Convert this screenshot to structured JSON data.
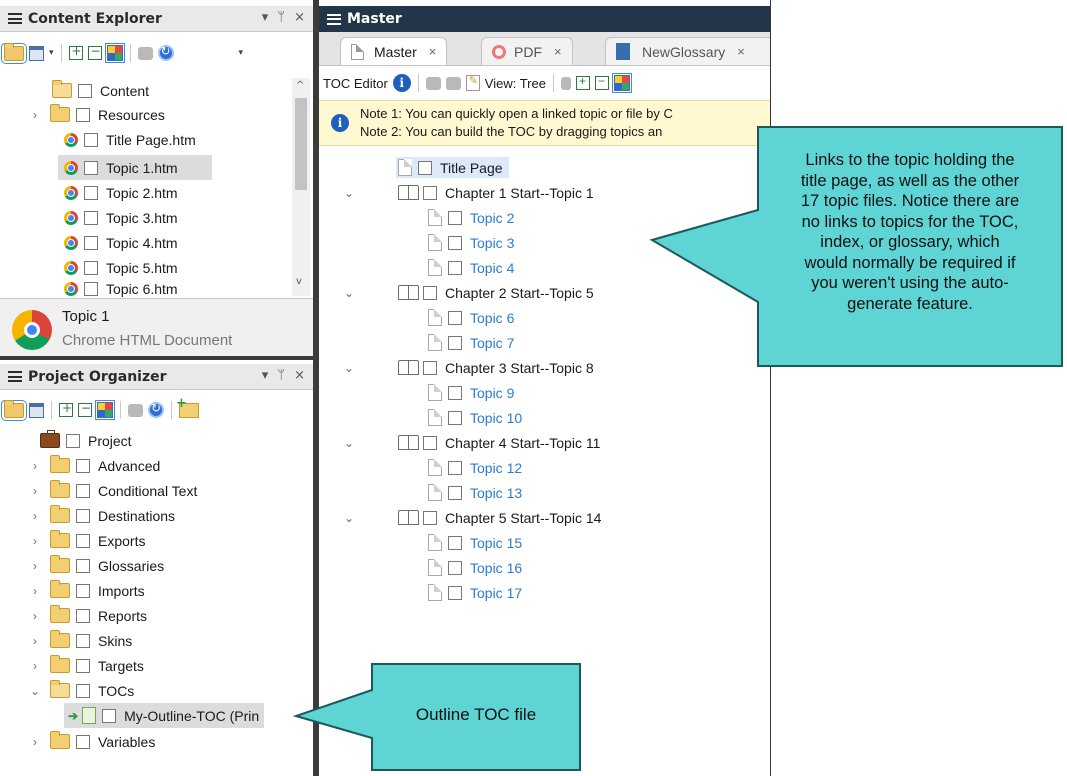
{
  "content_explorer": {
    "title": "Content Explorer",
    "controls": {
      "dropdown": "▾",
      "pin": "ᛘ",
      "close": "×"
    },
    "items": [
      {
        "label": "Content",
        "icon": "folder-open-icon"
      },
      {
        "label": "Resources",
        "icon": "folder-icon"
      },
      {
        "label": "Title Page.htm",
        "icon": "chrome-icon"
      },
      {
        "label": "Topic 1.htm",
        "icon": "chrome-icon",
        "selected": true
      },
      {
        "label": "Topic 2.htm",
        "icon": "chrome-icon"
      },
      {
        "label": "Topic 3.htm",
        "icon": "chrome-icon"
      },
      {
        "label": "Topic 4.htm",
        "icon": "chrome-icon"
      },
      {
        "label": "Topic 5.htm",
        "icon": "chrome-icon"
      },
      {
        "label": "Topic 6.htm",
        "icon": "chrome-icon"
      }
    ],
    "preview": {
      "name": "Topic 1",
      "type": "Chrome HTML Document"
    }
  },
  "project_organizer": {
    "title": "Project Organizer",
    "items": [
      {
        "label": "Project"
      },
      {
        "label": "Advanced"
      },
      {
        "label": "Conditional Text"
      },
      {
        "label": "Destinations"
      },
      {
        "label": "Exports"
      },
      {
        "label": "Glossaries"
      },
      {
        "label": "Imports"
      },
      {
        "label": "Reports"
      },
      {
        "label": "Skins"
      },
      {
        "label": "Targets"
      },
      {
        "label": "TOCs"
      },
      {
        "label": "My-Outline-TOC (Prin"
      },
      {
        "label": "Variables"
      }
    ]
  },
  "master": {
    "title": "Master",
    "tabs": [
      {
        "label": "Master",
        "close": "×",
        "active": true
      },
      {
        "label": "PDF",
        "close": "×"
      },
      {
        "label": "NewGlossary",
        "close": "×"
      }
    ],
    "toolbar": {
      "label": "TOC Editor",
      "view_label": "View: Tree"
    },
    "notes": [
      "Note 1: You can quickly open a linked topic or file by C",
      "Note 2: You can build the TOC by dragging topics an"
    ],
    "toc": [
      {
        "label": "Title Page",
        "kind": "page",
        "level": 0
      },
      {
        "label": "Chapter 1 Start--Topic 1",
        "kind": "book",
        "level": 0
      },
      {
        "label": "Topic 2",
        "kind": "link",
        "level": 1
      },
      {
        "label": "Topic 3",
        "kind": "link",
        "level": 1
      },
      {
        "label": "Topic 4",
        "kind": "link",
        "level": 1
      },
      {
        "label": "Chapter 2 Start--Topic 5",
        "kind": "book",
        "level": 0
      },
      {
        "label": "Topic 6",
        "kind": "link",
        "level": 1
      },
      {
        "label": "Topic 7",
        "kind": "link",
        "level": 1
      },
      {
        "label": "Chapter 3 Start--Topic 8",
        "kind": "book",
        "level": 0
      },
      {
        "label": "Topic 9",
        "kind": "link",
        "level": 1
      },
      {
        "label": "Topic 10",
        "kind": "link",
        "level": 1
      },
      {
        "label": "Chapter 4 Start--Topic 11",
        "kind": "book",
        "level": 0
      },
      {
        "label": "Topic 12",
        "kind": "link",
        "level": 1
      },
      {
        "label": "Topic 13",
        "kind": "link",
        "level": 1
      },
      {
        "label": "Chapter 5 Start--Topic 14",
        "kind": "book",
        "level": 0
      },
      {
        "label": "Topic 15",
        "kind": "link",
        "level": 1
      },
      {
        "label": "Topic 16",
        "kind": "link",
        "level": 1
      },
      {
        "label": "Topic 17",
        "kind": "link",
        "level": 1
      }
    ]
  },
  "callouts": {
    "toc_links": {
      "lines": [
        "Links to the topic holding the",
        "title page, as well as the other",
        "17 topic files. Notice there are",
        "no links to topics for the TOC,",
        "index, or glossary, which",
        "would normally be required if",
        "you weren't using the auto-",
        "generate feature."
      ]
    },
    "outline_toc": {
      "text": "Outline TOC file"
    }
  },
  "colors": {
    "callout_fill": "#5fd4d4",
    "link_blue": "#2b7cd3",
    "master_header": "#223549",
    "note_bg": "#fff8d0"
  }
}
